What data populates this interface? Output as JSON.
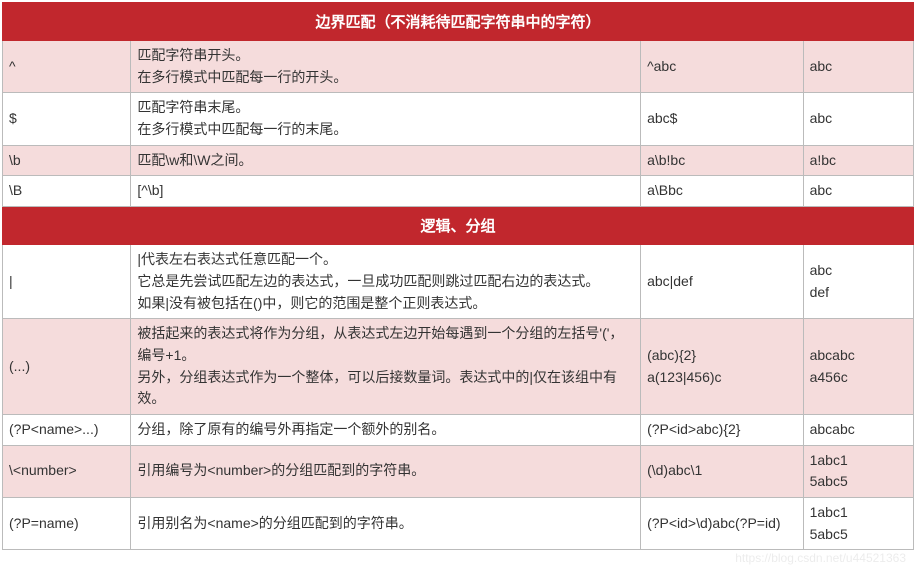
{
  "watermark": "https://blog.csdn.net/u44521363",
  "sections": [
    {
      "title": "边界匹配（不消耗待匹配字符串中的字符）",
      "rows": [
        {
          "alt": true,
          "symbol": "^",
          "desc": [
            "匹配字符串开头。",
            "在多行模式中匹配每一行的开头。"
          ],
          "example": "^abc",
          "result": [
            "abc"
          ]
        },
        {
          "alt": false,
          "symbol": "$",
          "desc": [
            "匹配字符串末尾。",
            "在多行模式中匹配每一行的末尾。"
          ],
          "example": "abc$",
          "result": [
            "abc"
          ]
        },
        {
          "alt": true,
          "symbol": "\\b",
          "desc": [
            "匹配\\w和\\W之间。"
          ],
          "example": "a\\b!bc",
          "result": [
            "a!bc"
          ]
        },
        {
          "alt": false,
          "symbol": "\\B",
          "desc": [
            "[^\\b]"
          ],
          "example": "a\\Bbc",
          "result": [
            "abc"
          ]
        }
      ]
    },
    {
      "title": "逻辑、分组",
      "rows": [
        {
          "alt": false,
          "symbol": "|",
          "desc": [
            "|代表左右表达式任意匹配一个。",
            "它总是先尝试匹配左边的表达式，一旦成功匹配则跳过匹配右边的表达式。",
            "如果|没有被包括在()中，则它的范围是整个正则表达式。"
          ],
          "example": "abc|def",
          "result": [
            "abc",
            "def"
          ]
        },
        {
          "alt": true,
          "symbol": "(...)",
          "desc": [
            "被括起来的表达式将作为分组，从表达式左边开始每遇到一个分组的左括号'('，编号+1。",
            "另外，分组表达式作为一个整体，可以后接数量词。表达式中的|仅在该组中有效。"
          ],
          "example": "(abc){2}\na(123|456)c",
          "result": [
            "abcabc",
            "a456c"
          ]
        },
        {
          "alt": false,
          "symbol": "(?P<name>...)",
          "desc": [
            "分组，除了原有的编号外再指定一个额外的别名。"
          ],
          "example": "(?P<id>abc){2}",
          "result": [
            "abcabc"
          ]
        },
        {
          "alt": true,
          "symbol": "\\<number>",
          "desc": [
            "引用编号为<number>的分组匹配到的字符串。"
          ],
          "example": "(\\d)abc\\1",
          "result": [
            "1abc1",
            "5abc5"
          ]
        },
        {
          "alt": false,
          "symbol": "(?P=name)",
          "desc": [
            "引用别名为<name>的分组匹配到的字符串。"
          ],
          "example": "(?P<id>\\d)abc(?P=id)",
          "result": [
            "1abc1",
            "5abc5"
          ]
        }
      ]
    }
  ]
}
